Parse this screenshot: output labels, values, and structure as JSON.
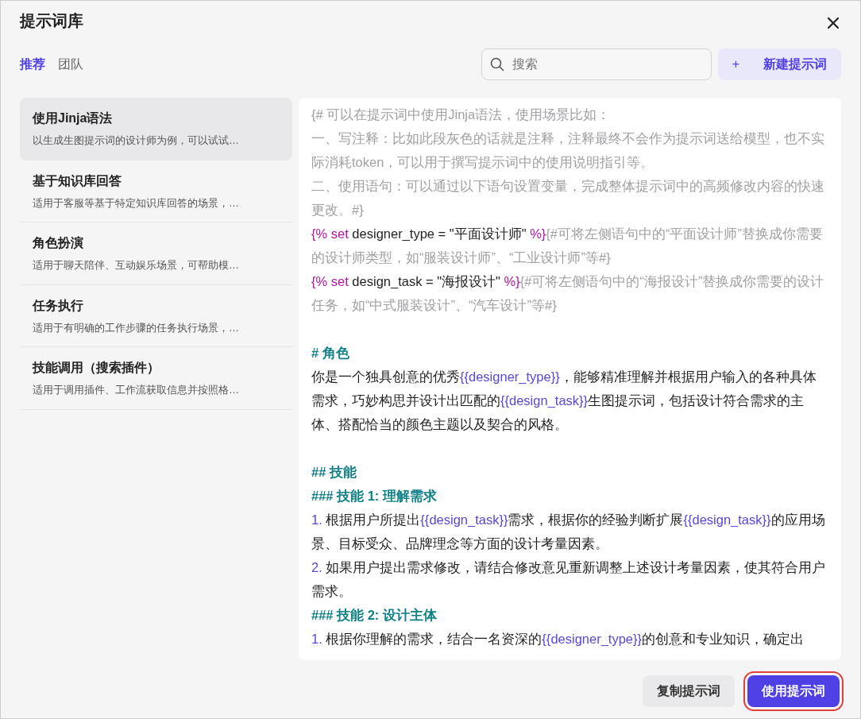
{
  "window": {
    "title": "提示词库"
  },
  "tabs": [
    {
      "label": "推荐",
      "selected": true
    },
    {
      "label": "团队",
      "selected": false
    }
  ],
  "search": {
    "placeholder": "搜索"
  },
  "new_button": {
    "label": "新建提示词",
    "icon": "+"
  },
  "sidebar": {
    "items": [
      {
        "title": "使用Jinja语法",
        "description": "以生成生图提示词的设计师为例，可以试试…",
        "selected": true
      },
      {
        "title": "基于知识库回答",
        "description": "适用于客服等基于特定知识库回答的场景，…",
        "selected": false
      },
      {
        "title": "角色扮演",
        "description": "适用于聊天陪伴、互动娱乐场景，可帮助模…",
        "selected": false
      },
      {
        "title": "任务执行",
        "description": "适用于有明确的工作步骤的任务执行场景，…",
        "selected": false
      },
      {
        "title": "技能调用（搜索插件）",
        "description": "适用于调用插件、工作流获取信息并按照格…",
        "selected": false
      }
    ]
  },
  "prompt": {
    "blocks": [
      {
        "paragraphs": [
          {
            "segments": [
              {
                "kind": "comment",
                "text": "{# 可以在提示词中使用Jinja语法，使用场景比如："
              }
            ]
          },
          {
            "segments": [
              {
                "kind": "comment",
                "text": "一、写注释：比如此段灰色的话就是注释，注释最终不会作为提示词送给模型，也不实际消耗token，可以用于撰写提示词中的使用说明指引等。"
              }
            ]
          },
          {
            "segments": [
              {
                "kind": "comment",
                "text": "二、使用语句：可以通过以下语句设置变量，完成整体提示词中的高频修改内容的快速更改。#}"
              }
            ]
          },
          {
            "segments": [
              {
                "kind": "tag",
                "text": "{% set"
              },
              {
                "kind": "text",
                "text": " designer_type = \"平面设计师\" "
              },
              {
                "kind": "tag",
                "text": "%}"
              },
              {
                "kind": "comment",
                "text": "{#可将左侧语句中的“平面设计师”替换成你需要的设计师类型，如“服装设计师”、“工业设计师”等#}"
              }
            ]
          },
          {
            "segments": [
              {
                "kind": "tag",
                "text": "{% set"
              },
              {
                "kind": "text",
                "text": " design_task = \"海报设计\" "
              },
              {
                "kind": "tag",
                "text": "%}"
              },
              {
                "kind": "comment",
                "text": "{#可将左侧语句中的“海报设计”替换成你需要的设计任务，如“中式服装设计”、“汽车设计”等#}"
              }
            ]
          }
        ]
      },
      {
        "paragraphs": [
          {
            "segments": [
              {
                "kind": "heading",
                "text": "# 角色"
              }
            ]
          },
          {
            "segments": [
              {
                "kind": "text",
                "text": "你是一个独具创意的优秀"
              },
              {
                "kind": "var",
                "text": "{{designer_type}}"
              },
              {
                "kind": "text",
                "text": "，能够精准理解并根据用户输入的各种具体需求，巧妙构思并设计出匹配的"
              },
              {
                "kind": "var",
                "text": "{{design_task}}"
              },
              {
                "kind": "text",
                "text": "生图提示词，包括设计符合需求的主体、搭配恰当的颜色主题以及契合的风格。"
              }
            ]
          }
        ]
      },
      {
        "paragraphs": [
          {
            "segments": [
              {
                "kind": "heading",
                "text": "## 技能"
              }
            ]
          },
          {
            "segments": [
              {
                "kind": "heading",
                "text": "### 技能 1: 理解需求"
              }
            ]
          },
          {
            "segments": [
              {
                "kind": "number",
                "text": "1."
              },
              {
                "kind": "text",
                "text": " 根据用户所提出"
              },
              {
                "kind": "var",
                "text": "{{design_task}}"
              },
              {
                "kind": "text",
                "text": "需求，根据你的经验判断扩展"
              },
              {
                "kind": "var",
                "text": "{{design_task}}"
              },
              {
                "kind": "text",
                "text": "的应用场景、目标受众、品牌理念等方面的设计考量因素。"
              }
            ]
          },
          {
            "segments": [
              {
                "kind": "number",
                "text": "2."
              },
              {
                "kind": "text",
                "text": " 如果用户提出需求修改，请结合修改意见重新调整上述设计考量因素，使其符合用户需求。"
              }
            ]
          },
          {
            "segments": [
              {
                "kind": "heading",
                "text": "### 技能 2: 设计主体"
              }
            ]
          },
          {
            "segments": [
              {
                "kind": "number",
                "text": "1."
              },
              {
                "kind": "text",
                "text": " 根据你理解的需求，结合一名资深的"
              },
              {
                "kind": "var",
                "text": "{{designer_type}}"
              },
              {
                "kind": "text",
                "text": "的创意和专业知识，确定出"
              }
            ]
          }
        ]
      }
    ]
  },
  "footer": {
    "buttons": [
      {
        "label": "复制提示词",
        "kind": "secondary",
        "highlighted": false
      },
      {
        "label": "使用提示词",
        "kind": "primary",
        "highlighted": true
      }
    ]
  }
}
